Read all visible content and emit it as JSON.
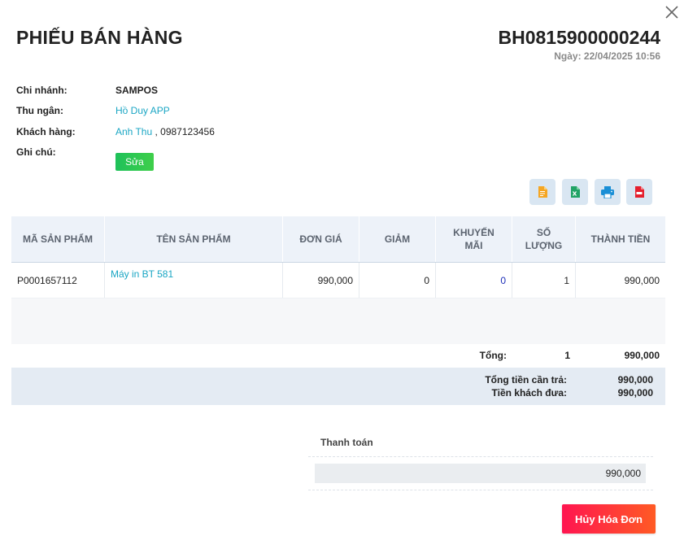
{
  "header": {
    "title": "PHIẾU BÁN HÀNG",
    "invoice_code": "BH0815900000244",
    "date": "Ngày: 22/04/2025 10:56"
  },
  "info": {
    "branch_label": "Chi nhánh:",
    "branch_value": "SAMPOS",
    "cashier_label": "Thu ngân:",
    "cashier_value": "Hồ Duy APP",
    "customer_label": "Khách hàng:",
    "customer_name": "Anh Thu",
    "customer_phone": " , 0987123456",
    "note_label": "Ghi chú:",
    "edit_label": "Sửa"
  },
  "toolbar": {
    "icons": [
      "document-icon",
      "excel-icon",
      "print-icon",
      "pdf-icon"
    ],
    "colors": {
      "document": "#f5a623",
      "excel": "#21a366",
      "print": "#1a8fd6",
      "pdf": "#e5202e"
    }
  },
  "table": {
    "headers": {
      "code": "MÃ SẢN PHẨM",
      "name": "TÊN SẢN PHẨM",
      "price": "ĐƠN GIÁ",
      "discount": "GIẢM",
      "promo_line1": "KHUYẾN",
      "promo_line2": "MÃI",
      "qty_line1": "SỐ",
      "qty_line2": "LƯỢNG",
      "total": "THÀNH TIỀN"
    },
    "rows": [
      {
        "code": "P0001657112",
        "name": "Máy in BT 581",
        "price": "990,000",
        "discount": "0",
        "promo": "0",
        "qty": "1",
        "total": "990,000"
      }
    ]
  },
  "totals": {
    "label": "Tổng:",
    "qty": "1",
    "amount": "990,000",
    "payable_label": "Tổng tiền cần trả:",
    "payable_value": "990,000",
    "paid_label": "Tiền khách đưa:",
    "paid_value": "990,000"
  },
  "payment": {
    "title": "Thanh toán",
    "amount": "990,000"
  },
  "actions": {
    "cancel_label": "Hủy Hóa Đơn"
  }
}
